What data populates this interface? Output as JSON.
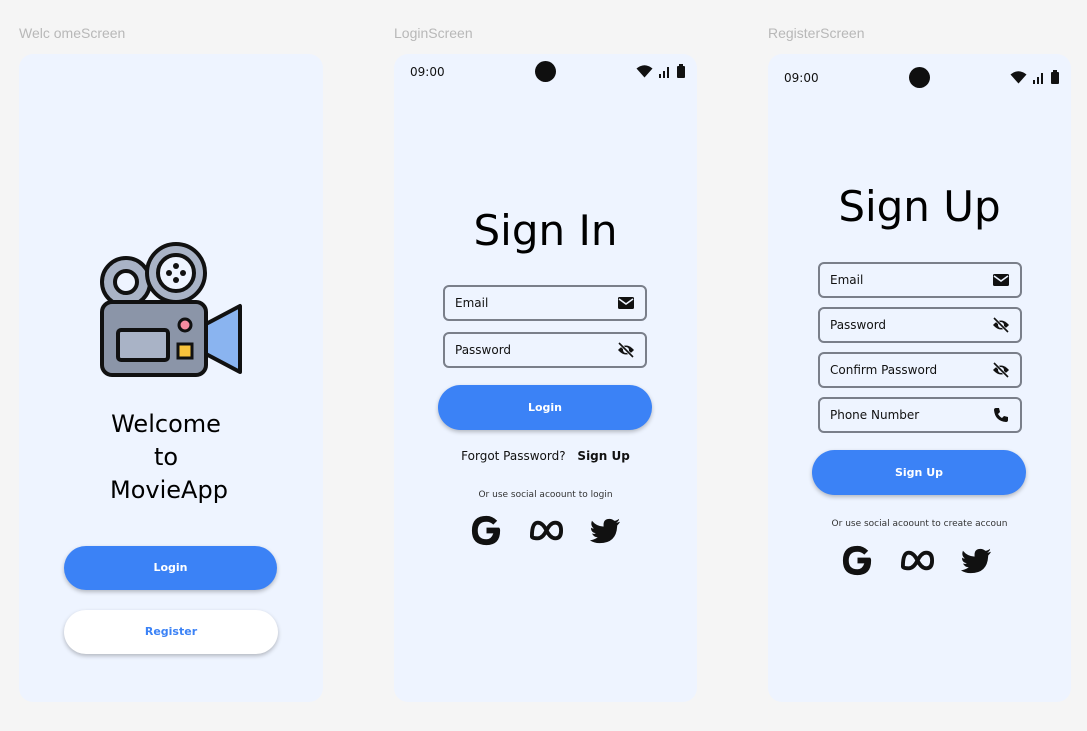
{
  "frames": {
    "welcome_label": "Welc omeScreen",
    "login_label": "LoginScreen",
    "register_label": "RegisterScreen"
  },
  "welcome": {
    "title_line1": "Welcome",
    "title_line2": "to",
    "title_line3": "MovieApp",
    "login_button": "Login",
    "register_button": "Register",
    "logo_icon": "movie-camera-icon"
  },
  "login": {
    "status_time": "09:00",
    "title": "Sign In",
    "email_placeholder": "Email",
    "password_placeholder": "Password",
    "login_button": "Login",
    "forgot_password": "Forgot Password?",
    "sign_up_link": "Sign Up",
    "social_text": "Or use social acoount to login",
    "social_icons": [
      "google-icon",
      "meta-icon",
      "twitter-icon"
    ]
  },
  "register": {
    "status_time": "09:00",
    "title": "Sign Up",
    "email_placeholder": "Email",
    "password_placeholder": "Password",
    "confirm_password_placeholder": "Confirm Password",
    "phone_placeholder": "Phone Number",
    "sign_up_button": "Sign Up",
    "social_text": "Or use social acoount to create accoun",
    "social_icons": [
      "google-icon",
      "meta-icon",
      "twitter-icon"
    ]
  },
  "colors": {
    "primary": "#3b82f6",
    "screen_bg": "#eef4ff",
    "canvas_bg": "#f5f5f5"
  }
}
